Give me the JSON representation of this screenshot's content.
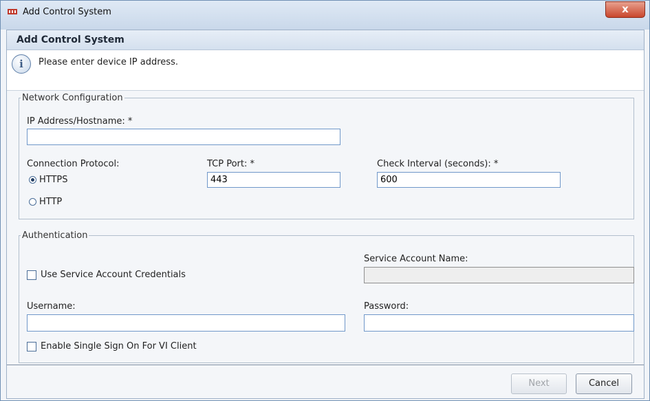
{
  "window": {
    "title": "Add Control System",
    "close_label": "x"
  },
  "dialog": {
    "header": "Add Control System",
    "info_text": "Please enter device IP address.",
    "info_icon": "i"
  },
  "network": {
    "legend": "Network Configuration",
    "ip_label": "IP Address/Hostname: *",
    "ip_value": "",
    "protocol_label": "Connection Protocol:",
    "protocol_options": [
      "HTTPS",
      "HTTP"
    ],
    "protocol_selected": "HTTPS",
    "port_label": "TCP Port: *",
    "port_value": "443",
    "interval_label": "Check Interval (seconds): *",
    "interval_value": "600"
  },
  "auth": {
    "legend": "Authentication",
    "use_service_label": "Use Service Account Credentials",
    "use_service_checked": false,
    "service_name_label": "Service Account Name:",
    "service_name_value": "",
    "username_label": "Username:",
    "username_value": "",
    "password_label": "Password:",
    "password_value": "",
    "sso_label": "Enable Single Sign On For VI Client",
    "sso_checked": false
  },
  "buttons": {
    "next": "Next",
    "cancel": "Cancel"
  }
}
